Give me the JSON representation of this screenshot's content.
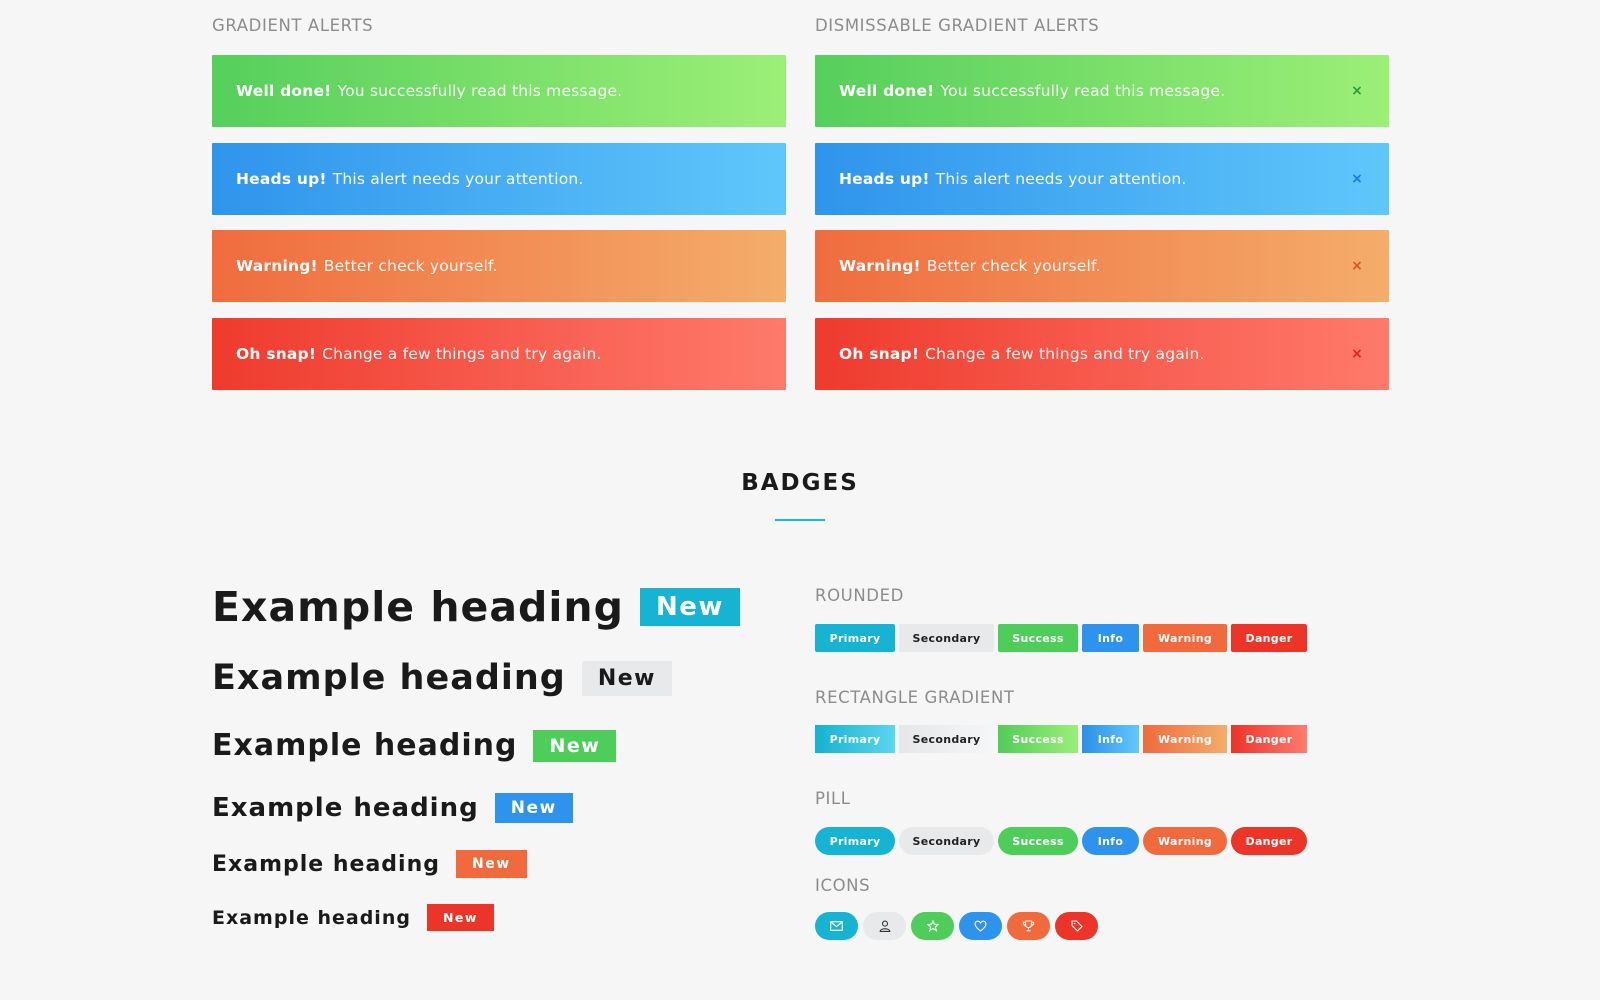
{
  "alerts": {
    "label": "GRADIENT ALERTS",
    "items": [
      {
        "strong": "Well done!",
        "text": "You successfully read this message."
      },
      {
        "strong": "Heads up!",
        "text": "This alert needs your attention."
      },
      {
        "strong": "Warning!",
        "text": "Better check yourself."
      },
      {
        "strong": "Oh snap!",
        "text": "Change a few things and try again."
      }
    ]
  },
  "dismissable": {
    "label": "DISMISSABLE GRADIENT ALERTS",
    "close": "×",
    "items": [
      {
        "strong": "Well done!",
        "text": "You successfully read this message."
      },
      {
        "strong": "Heads up!",
        "text": "This alert needs your attention."
      },
      {
        "strong": "Warning!",
        "text": "Better check yourself."
      },
      {
        "strong": "Oh snap!",
        "text": "Change a few things and try again."
      }
    ]
  },
  "badges": {
    "title": "BADGES",
    "headings": [
      {
        "text": "Example heading",
        "badge": "New",
        "color": "#16b3d2"
      },
      {
        "text": "Example heading",
        "badge": "New",
        "color": "#e7e9ea"
      },
      {
        "text": "Example heading",
        "badge": "New",
        "color": "#4fcd5a"
      },
      {
        "text": "Example heading",
        "badge": "New",
        "color": "#2d93ec"
      },
      {
        "text": "Example heading",
        "badge": "New",
        "color": "#f06a3e"
      },
      {
        "text": "Example heading",
        "badge": "New",
        "color": "#ec3428"
      }
    ],
    "labels": [
      "Primary",
      "Secondary",
      "Success",
      "Info",
      "Warning",
      "Danger"
    ],
    "rounded_label": "ROUNDED",
    "gradient_label": "RECTANGLE GRADIENT",
    "pill_label": "PILL",
    "icons_label": "ICONS",
    "icons": [
      "envelope-icon",
      "user-icon",
      "star-icon",
      "heart-icon",
      "trophy-icon",
      "tag-icon"
    ]
  },
  "colors": {
    "primary": "#16b3d2",
    "secondary": "#e7e9ea",
    "success": "#4fcd5a",
    "info": "#2d93ec",
    "warning": "#f06a3e",
    "danger": "#ec3428"
  }
}
